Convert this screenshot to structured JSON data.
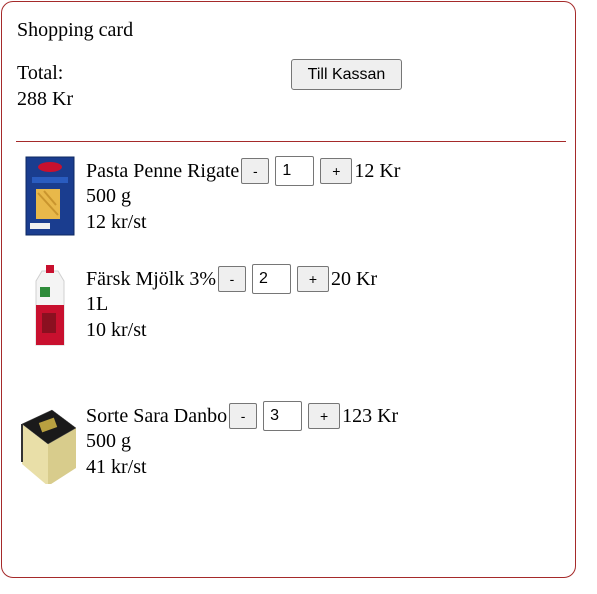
{
  "cart": {
    "title": "Shopping card",
    "total_label": "Total:",
    "total_value": "288 Kr",
    "checkout_label": "Till Kassan"
  },
  "items": [
    {
      "name": "Pasta Penne Rigate",
      "minus_label": "-",
      "quantity": "1",
      "plus_label": "+",
      "price": "12 Kr",
      "size": "500 g",
      "unit_price": "12 kr/st",
      "image_icon": "pasta-box-icon"
    },
    {
      "name": "Färsk Mjölk 3%",
      "minus_label": "-",
      "quantity": "2",
      "plus_label": "+",
      "price": "20 Kr",
      "size": "1L",
      "unit_price": "10 kr/st",
      "image_icon": "milk-carton-icon"
    },
    {
      "name": "Sorte Sara Danbo",
      "minus_label": "-",
      "quantity": "3",
      "plus_label": "+",
      "price": "123 Kr",
      "size": "500 g",
      "unit_price": "41 kr/st",
      "image_icon": "cheese-block-icon"
    }
  ],
  "colors": {
    "border": "#a52a2a",
    "button_bg": "#efefef"
  }
}
